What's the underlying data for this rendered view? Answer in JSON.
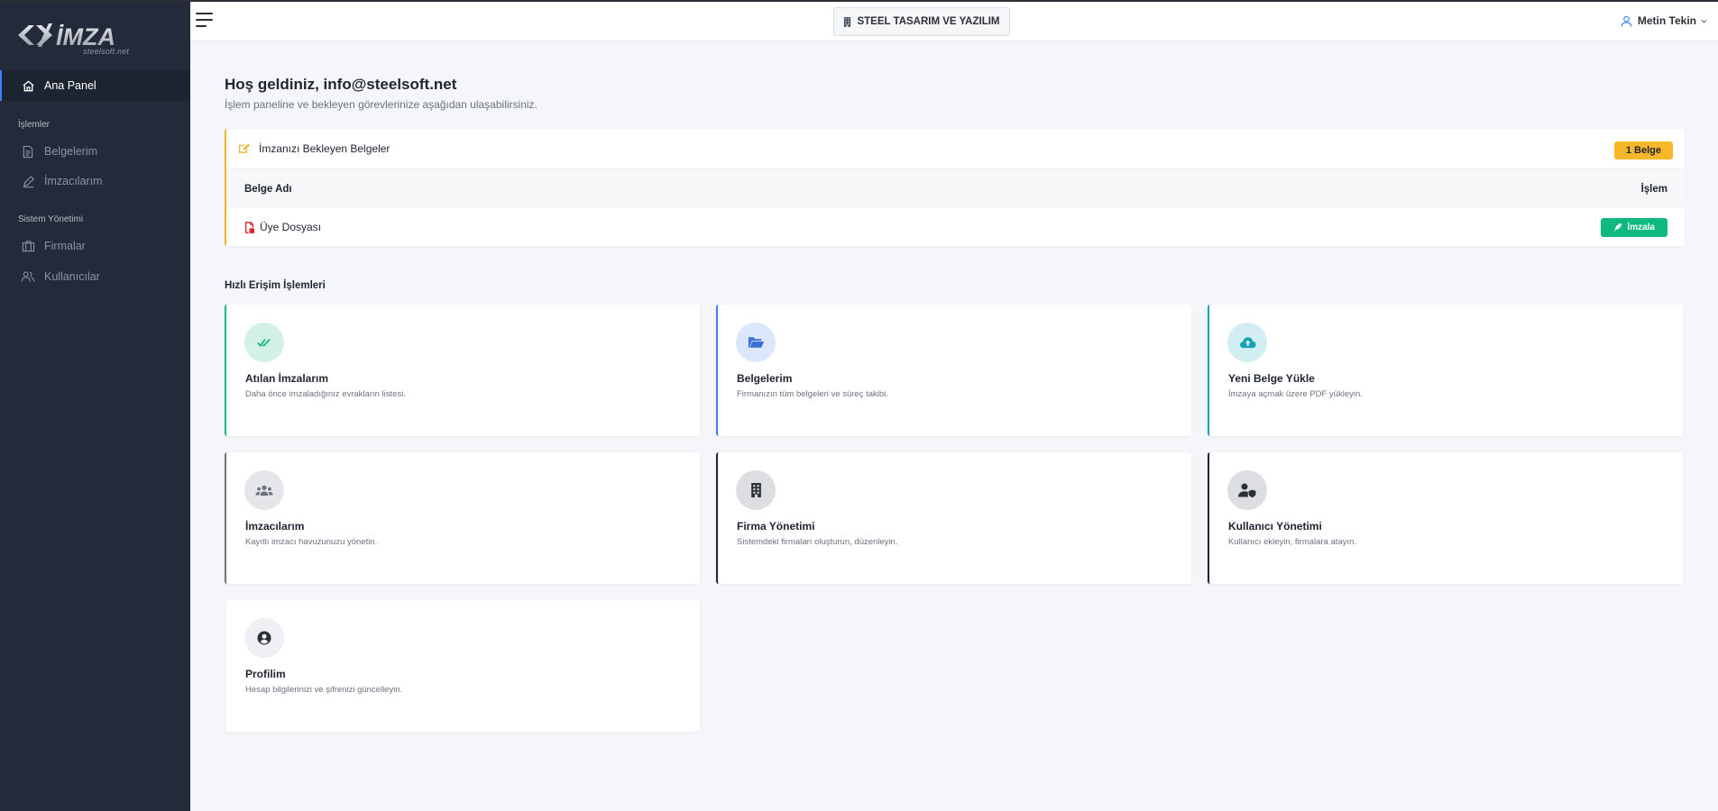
{
  "app": {
    "logo_text": "İMZA",
    "logo_sub": "steelsoft.net"
  },
  "sidebar": {
    "items": [
      {
        "label": "Ana Panel",
        "icon": "home-icon",
        "active": true
      },
      {
        "label": "Belgelerim",
        "icon": "document-icon"
      },
      {
        "label": "İmzacılarım",
        "icon": "pen-icon"
      },
      {
        "label": "Firmalar",
        "icon": "building-icon"
      },
      {
        "label": "Kullanıcılar",
        "icon": "users-icon"
      }
    ],
    "sections": [
      "İşlemler",
      "Sistem Yönetimi"
    ]
  },
  "header": {
    "company": "STEEL TASARIM VE YAZILIM",
    "user": "Metin Tekin"
  },
  "main": {
    "welcome": "Hoş geldiniz, info@steelsoft.net",
    "welcome_sub": "İşlem paneline ve bekleyen görevlerinize aşağıdan ulaşabilirsiniz.",
    "pending": {
      "title": "İmzanızı Bekleyen Belgeler",
      "badge": "1 Belge",
      "col_name": "Belge Adı",
      "col_action": "İşlem",
      "rows": [
        {
          "name": "Üye Dosyası",
          "action": "İmzala"
        }
      ]
    },
    "quick_title": "Hızlı Erişim İşlemleri",
    "cards": [
      {
        "title": "Atılan İmzalarım",
        "desc": "Daha önce imzaladığınız evrakların listesi."
      },
      {
        "title": "Belgelerim",
        "desc": "Firmanızın tüm belgeleri ve süreç takibi."
      },
      {
        "title": "Yeni Belge Yükle",
        "desc": "İmzaya açmak üzere PDF yükleyin."
      },
      {
        "title": "İmzacılarım",
        "desc": "Kayıtlı imzacı havuzunuzu yönetin."
      },
      {
        "title": "Firma Yönetimi",
        "desc": "Sistemdeki firmaları oluşturun, düzenleyin."
      },
      {
        "title": "Kullanıcı Yönetimi",
        "desc": "Kullanıcı ekleyin, firmalara atayın."
      },
      {
        "title": "Profilim",
        "desc": "Hesap bilgilerinizi ve şifrenizi güncelleyin."
      }
    ]
  },
  "colors": {
    "sidebar_bg": "#232b3a",
    "accent_blue": "#3b82f6",
    "warning": "#f6b82a",
    "success": "#10b981",
    "teal": "#17a2b8"
  }
}
